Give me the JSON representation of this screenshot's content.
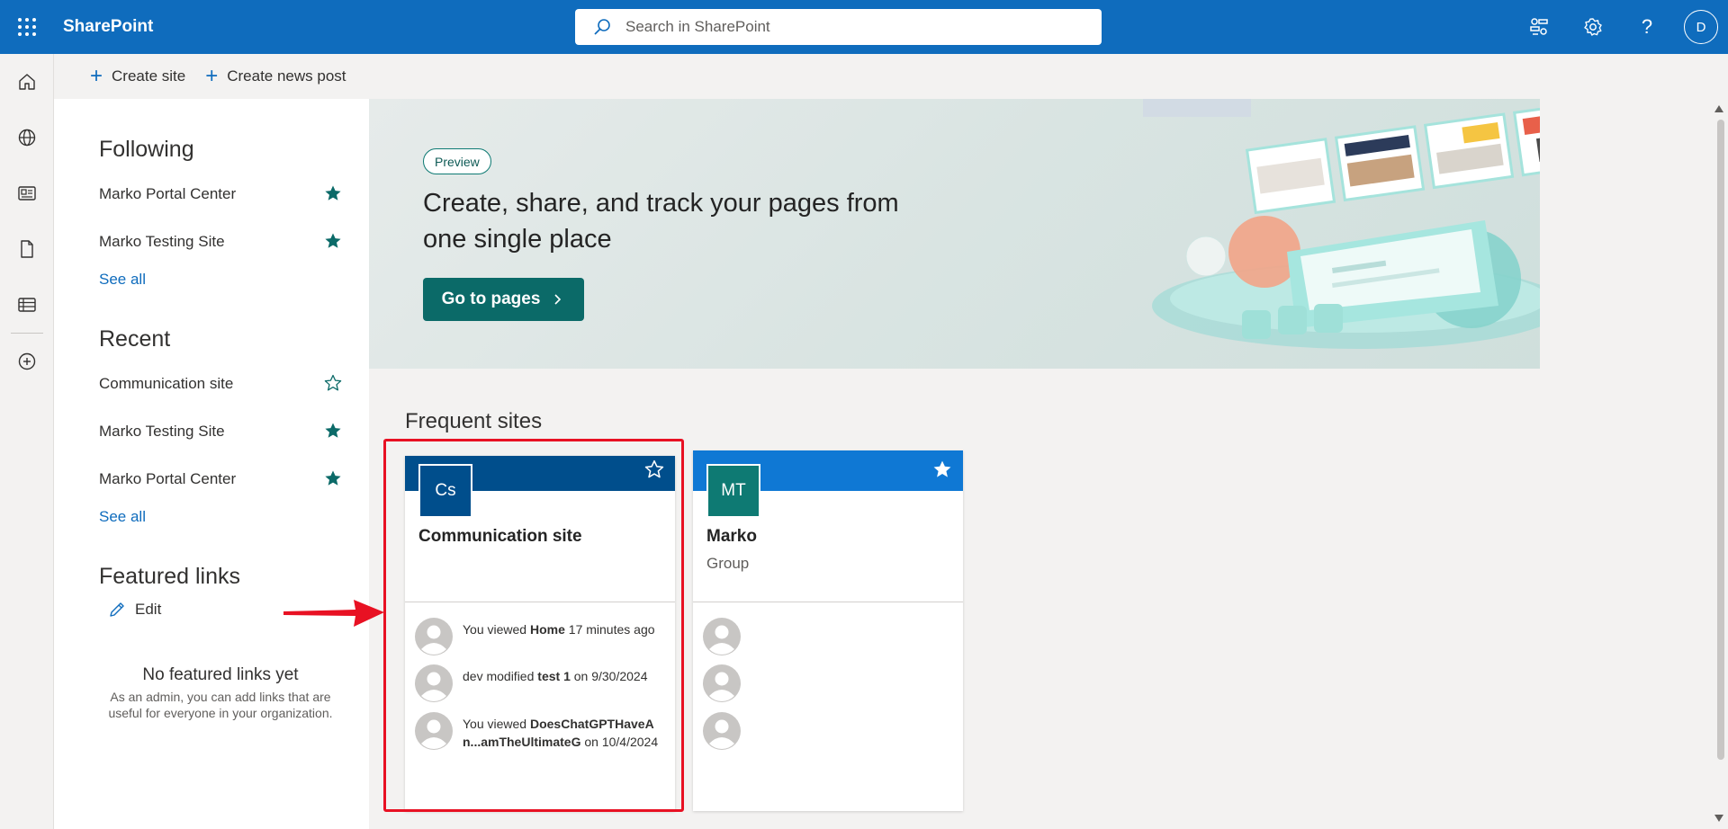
{
  "topbar": {
    "app_name": "SharePoint",
    "search_placeholder": "Search in SharePoint",
    "avatar_initial": "D"
  },
  "commandbar": {
    "create_site": "Create site",
    "create_news_post": "Create news post"
  },
  "following": {
    "title": "Following",
    "items": [
      {
        "label": "Marko Portal Center",
        "starred": true
      },
      {
        "label": "Marko Testing Site",
        "starred": true
      }
    ],
    "see_all": "See all"
  },
  "recent": {
    "title": "Recent",
    "items": [
      {
        "label": "Communication site",
        "starred": false
      },
      {
        "label": "Marko Testing Site",
        "starred": true
      },
      {
        "label": "Marko Portal Center",
        "starred": true
      }
    ],
    "see_all": "See all"
  },
  "featured": {
    "title": "Featured links",
    "edit": "Edit",
    "empty_title": "No featured links yet",
    "empty_desc": "As an admin, you can add links that are useful for everyone in your organization."
  },
  "hero": {
    "badge": "Preview",
    "title": "Create, share, and track your pages from one single place",
    "button": "Go to pages"
  },
  "frequent": {
    "title": "Frequent sites",
    "cards": [
      {
        "logo": "Cs",
        "name": "Communication site",
        "subtitle": "",
        "head_color": "#004e8c",
        "logo_color": "#004e8c",
        "starred": false,
        "activities": [
          {
            "prefix": "You viewed ",
            "bold": "Home",
            "suffix": " 17 minutes ago"
          },
          {
            "prefix": "dev modified ",
            "bold": "test 1",
            "suffix": " on 9/30/2024"
          },
          {
            "prefix": "You viewed ",
            "bold": "DoesChatGPTHaveAn...amTheUltimateG",
            "suffix": " on 10/4/2024"
          }
        ]
      },
      {
        "logo": "MT",
        "name": "Marko",
        "subtitle": "Group",
        "head_color": "#0f78d4",
        "logo_color": "#0e7a73",
        "starred": true,
        "activities": []
      }
    ]
  },
  "colors": {
    "brand": "#0f6cbd",
    "accent_teal": "#0b6a68",
    "highlight_red": "#e81123"
  }
}
